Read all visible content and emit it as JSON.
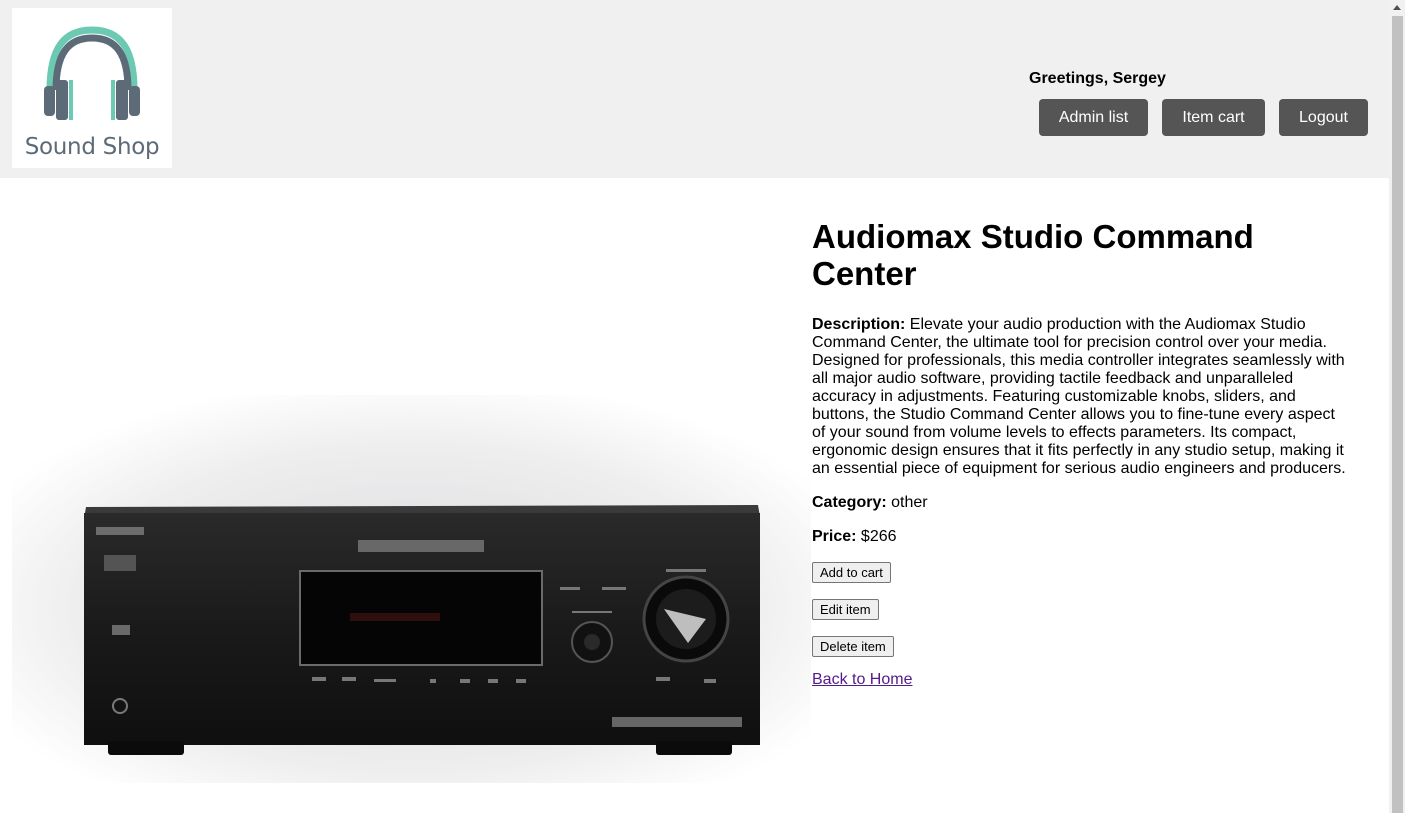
{
  "header": {
    "logo_text": "Sound Shop",
    "greeting": "Greetings, Sergey",
    "nav": {
      "admin_list": "Admin list",
      "item_cart": "Item cart",
      "logout": "Logout"
    }
  },
  "product": {
    "title": "Audiomax Studio Command Center",
    "description_label": "Description:",
    "description": "Elevate your audio production with the Audiomax Studio Command Center, the ultimate tool for precision control over your media. Designed for professionals, this media controller integrates seamlessly with all major audio software, providing tactile feedback and unparalleled accuracy in adjustments. Featuring customizable knobs, sliders, and buttons, the Studio Command Center allows you to fine-tune every aspect of your sound from volume levels to effects parameters. Its compact, ergonomic design ensures that it fits perfectly in any studio setup, making it an essential piece of equipment for serious audio engineers and producers.",
    "category_label": "Category:",
    "category": "other",
    "price_label": "Price:",
    "price": "$266",
    "image_icon": "av-receiver-image"
  },
  "actions": {
    "add_to_cart": "Add to cart",
    "edit_item": "Edit item",
    "delete_item": "Delete item",
    "back_home": "Back to Home"
  },
  "colors": {
    "header_bg": "#f0f0f0",
    "nav_button_bg": "#555555",
    "link_visited": "#551a8b",
    "logo_accent": "#6ccab2",
    "logo_dark": "#5d6b78"
  }
}
